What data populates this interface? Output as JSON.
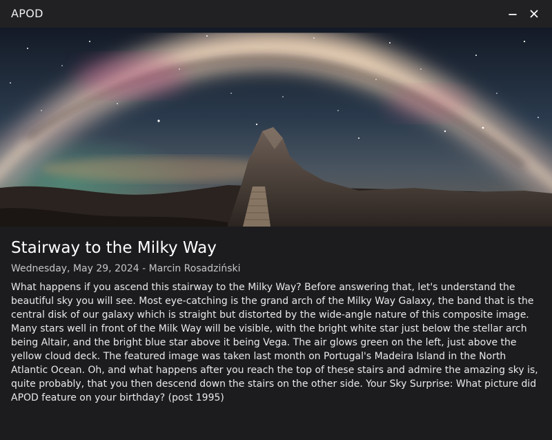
{
  "window": {
    "title": "APOD",
    "minimize_icon": "minimize-icon",
    "close_icon": "close-icon"
  },
  "hero_image": {
    "subject": "Milky Way arch over a rocky peak with a stairway"
  },
  "article": {
    "title": "Stairway to the Milky Way",
    "date": "Wednesday, May 29, 2024",
    "separator": " - ",
    "author": "Marcin Rosadziński",
    "explanation": "What happens if you ascend this stairway to the Milky Way? Before answering that, let's understand the beautiful sky you will see. Most eye-catching is the grand arch of the Milky Way Galaxy, the band that is the central disk of our galaxy which is straight but distorted by the wide-angle nature of this composite image. Many stars well in front of the Milk Way will be visible, with the bright white star just below the stellar arch being Altair, and the bright blue star above it being Vega. The air glows green on the left, just above the yellow cloud deck. The featured image was taken last month on Portugal's Madeira Island in the North Atlantic Ocean. Oh, and what happens after you reach the top of these stairs and admire the amazing sky is, quite probably, that you then descend down the stairs on the other side. Your Sky Surprise: What picture did APOD feature on your birthday? (post 1995)"
  },
  "colors": {
    "window_bg": "#1c1c1f",
    "titlebar_bg": "#212124",
    "text": "#ffffff",
    "meta_text": "#c6c6c6"
  }
}
